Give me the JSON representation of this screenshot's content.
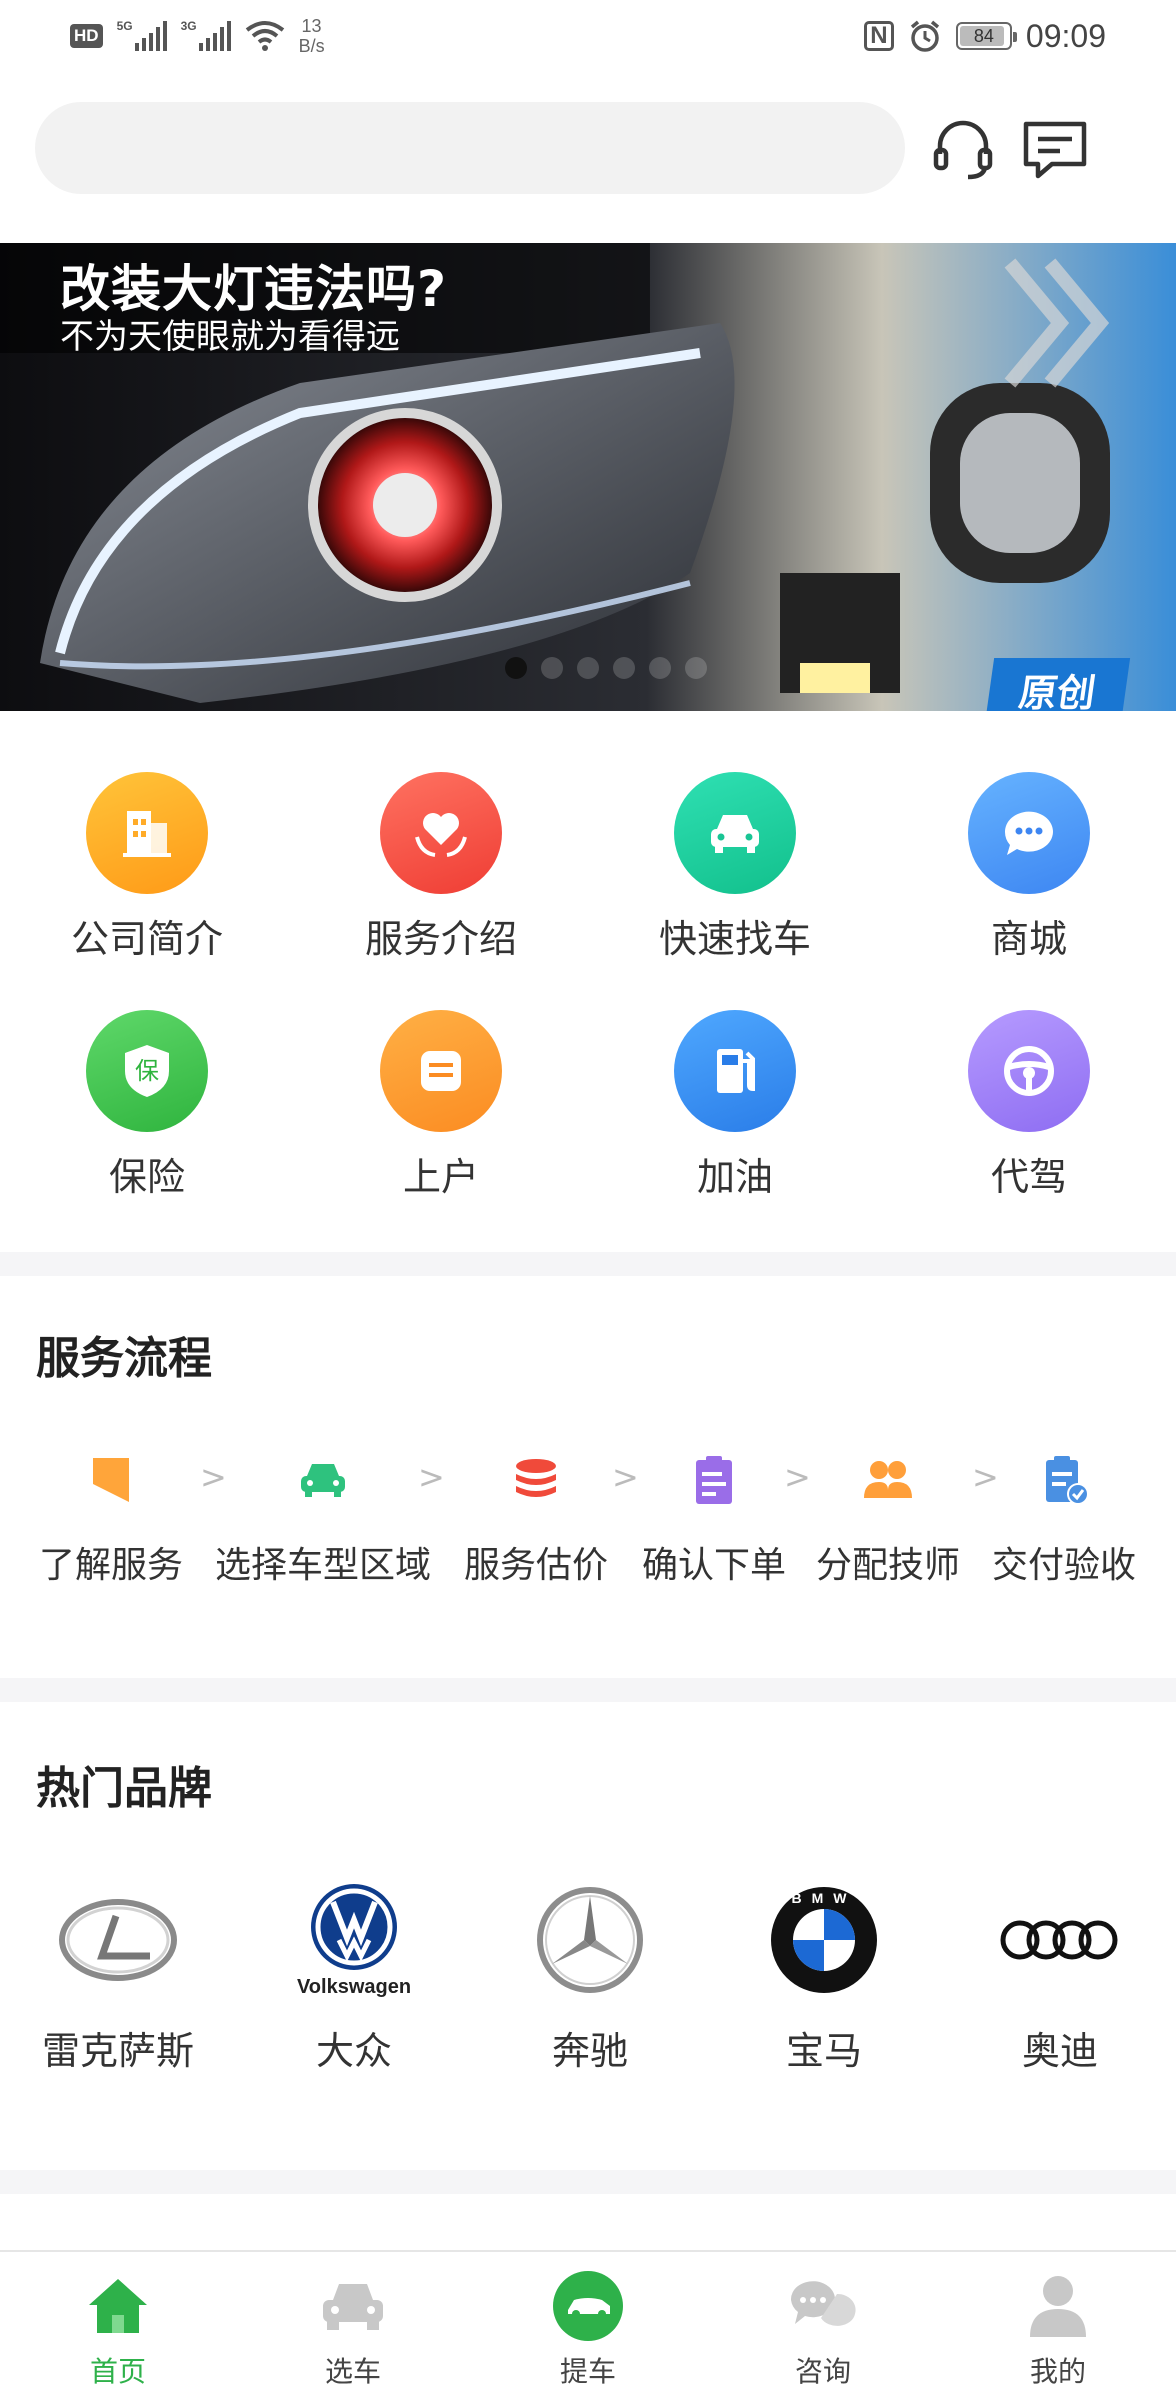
{
  "status_bar": {
    "hd": "HD",
    "sim1": "5G",
    "sim2": "3G",
    "speed_value": "13",
    "speed_unit": "B/s",
    "nfc": "N",
    "battery": "84",
    "time": "09:09"
  },
  "header": {
    "search_placeholder": "",
    "service_icon": "headset-icon",
    "message_icon": "message-icon"
  },
  "banner": {
    "title": "改装大灯违法吗?",
    "subtitle": "不为天使眼就为看得远",
    "stamp": "原创",
    "slide_count": 6,
    "active_slide": 0
  },
  "quick_grid": [
    {
      "label": "公司简介",
      "icon": "building-icon",
      "color_from": "#ffc43a",
      "color_to": "#ff9a17"
    },
    {
      "label": "服务介绍",
      "icon": "heart-hands-icon",
      "color_from": "#ff7261",
      "color_to": "#ef3d34"
    },
    {
      "label": "快速找车",
      "icon": "car-icon",
      "color_from": "#2fe0b3",
      "color_to": "#12c08c"
    },
    {
      "label": "商城",
      "icon": "chat-bubble-icon",
      "color_from": "#66b3ff",
      "color_to": "#3d86f2"
    },
    {
      "label": "保险",
      "icon": "insurance-shield-icon",
      "color_from": "#5fd86a",
      "color_to": "#2fb43e"
    },
    {
      "label": "上户",
      "icon": "document-icon",
      "color_from": "#ffb045",
      "color_to": "#fb8c22"
    },
    {
      "label": "加油",
      "icon": "fuel-icon",
      "color_from": "#4fa8ff",
      "color_to": "#2a7de8"
    },
    {
      "label": "代驾",
      "icon": "steering-wheel-icon",
      "color_from": "#b69bff",
      "color_to": "#8e6df2"
    }
  ],
  "process_section": {
    "title": "服务流程",
    "steps": [
      {
        "label": "了解服务",
        "icon": "bookmark-icon",
        "color": "#ffa53a"
      },
      {
        "label": "选择车型区域",
        "icon": "car-icon",
        "color": "#2ec27e"
      },
      {
        "label": "服务估价",
        "icon": "coins-icon",
        "color": "#f04a3a"
      },
      {
        "label": "确认下单",
        "icon": "clipboard-icon",
        "color": "#9a6de8"
      },
      {
        "label": "分配技师",
        "icon": "people-icon",
        "color": "#ff9f3a"
      },
      {
        "label": "交付验收",
        "icon": "checklist-icon",
        "color": "#4a90e2"
      }
    ],
    "arrow": ">"
  },
  "brands_section": {
    "title": "热门品牌",
    "brands": [
      {
        "label": "雷克萨斯",
        "logo": "lexus-logo"
      },
      {
        "label": "大众",
        "logo": "volkswagen-logo",
        "logo_text": "Volkswagen"
      },
      {
        "label": "奔驰",
        "logo": "mercedes-logo"
      },
      {
        "label": "宝马",
        "logo": "bmw-logo",
        "logo_text": "BMW"
      },
      {
        "label": "奥迪",
        "logo": "audi-logo"
      }
    ]
  },
  "tab_bar": {
    "active": 0,
    "accent": "#2eb14a",
    "tabs": [
      {
        "label": "首页",
        "icon": "home-icon"
      },
      {
        "label": "选车",
        "icon": "car-icon"
      },
      {
        "label": "提车",
        "icon": "car-pickup-icon"
      },
      {
        "label": "咨询",
        "icon": "chat-icon"
      },
      {
        "label": "我的",
        "icon": "user-icon"
      }
    ]
  }
}
